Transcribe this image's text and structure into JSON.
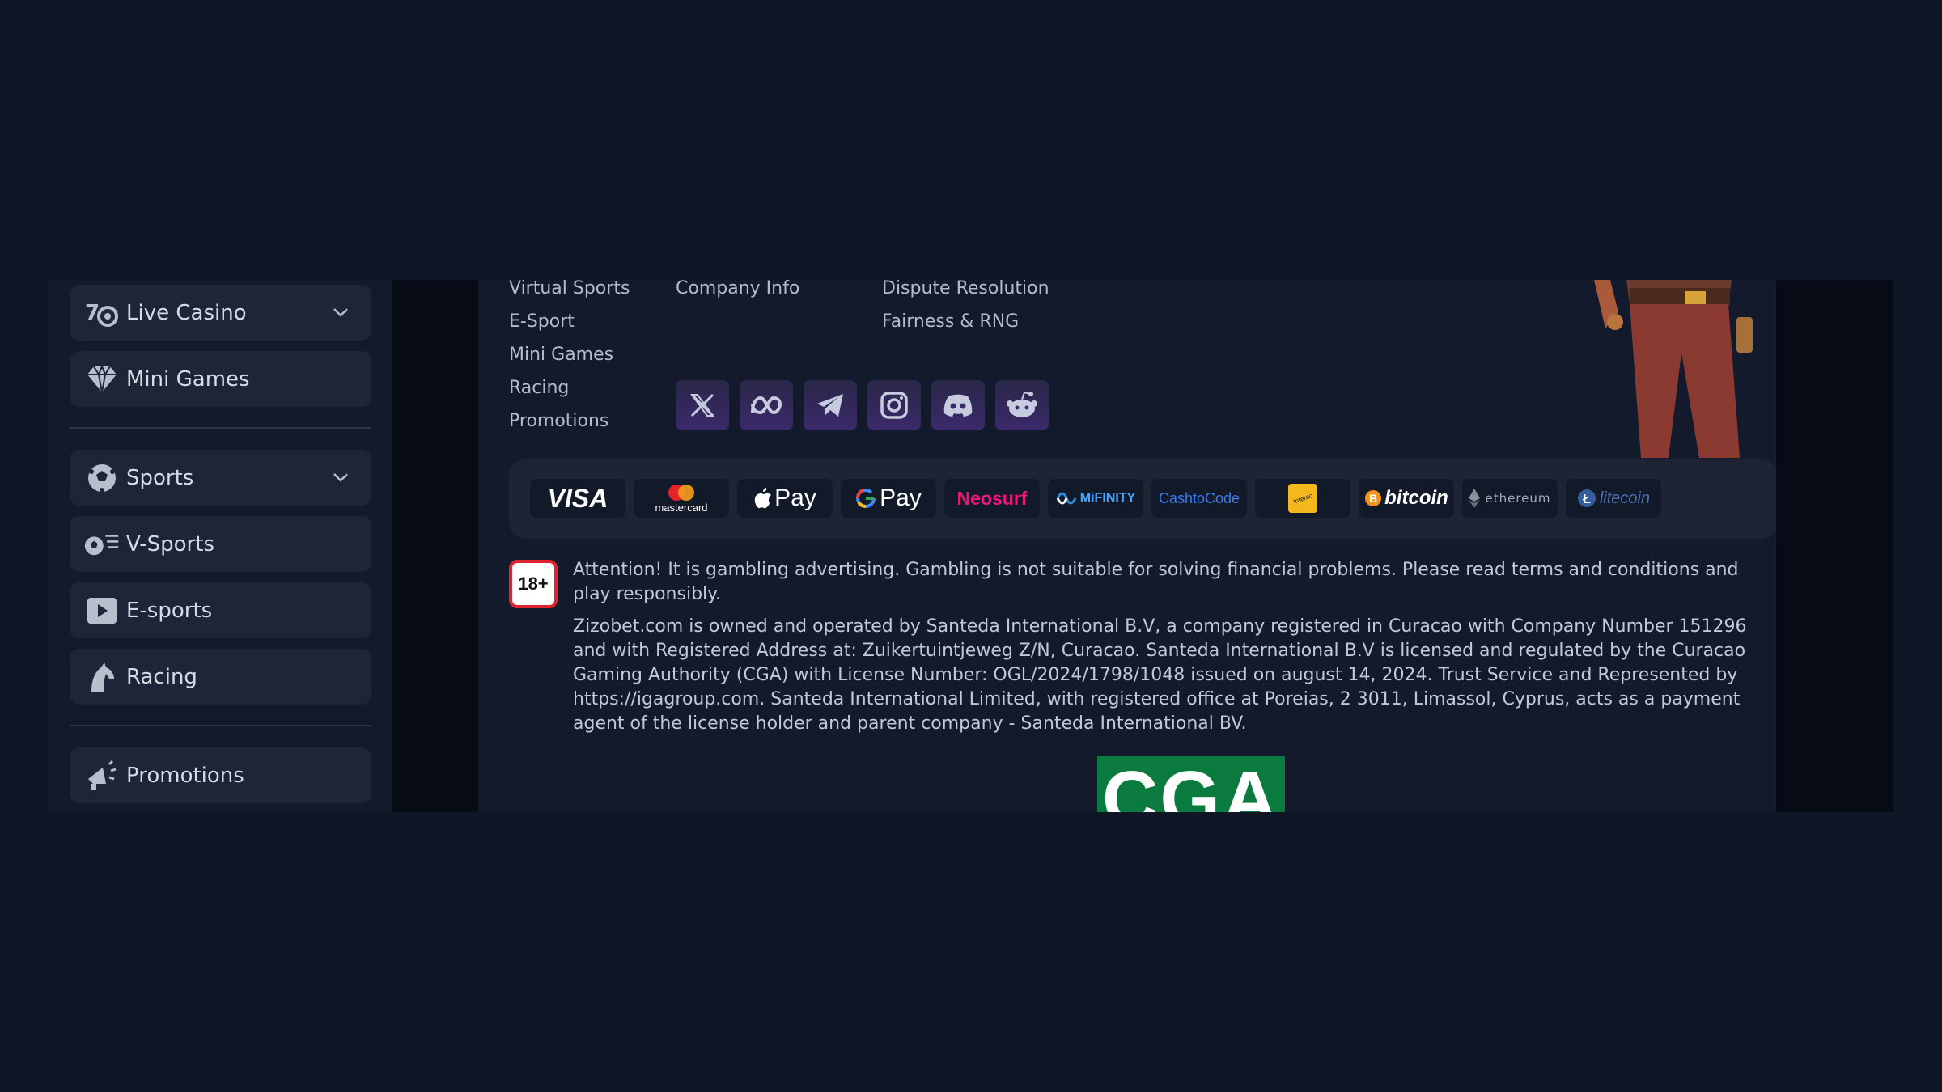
{
  "sidebar": {
    "items": [
      {
        "label": "Live Casino",
        "icon": "live-casino-icon",
        "expandable": true
      },
      {
        "label": "Mini Games",
        "icon": "diamond-icon",
        "expandable": false
      },
      {
        "label": "Sports",
        "icon": "soccer-ball-icon",
        "expandable": true
      },
      {
        "label": "V-Sports",
        "icon": "virtual-sports-icon",
        "expandable": false
      },
      {
        "label": "E-sports",
        "icon": "play-icon",
        "expandable": false
      },
      {
        "label": "Racing",
        "icon": "horse-icon",
        "expandable": false
      },
      {
        "label": "Promotions",
        "icon": "megaphone-icon",
        "expandable": false
      }
    ]
  },
  "footer": {
    "col1": [
      "Virtual Sports",
      "E-Sport",
      "Mini Games",
      "Racing",
      "Promotions"
    ],
    "col2": [
      "Company Info"
    ],
    "col3": [
      "Dispute Resolution",
      "Fairness & RNG"
    ],
    "socials": [
      "x-icon",
      "meta-icon",
      "telegram-icon",
      "instagram-icon",
      "discord-icon",
      "reddit-icon"
    ],
    "payments": [
      {
        "name": "VISA",
        "icon": "visa-logo"
      },
      {
        "name": "mastercard",
        "icon": "mastercard-logo"
      },
      {
        "name": "Pay",
        "icon": "apple-pay-logo"
      },
      {
        "name": "Pay",
        "icon": "google-pay-logo"
      },
      {
        "name": "Neosurf",
        "icon": "neosurf-logo"
      },
      {
        "name": "MiFINITY",
        "icon": "mifinity-logo"
      },
      {
        "name": "CashtoCode",
        "icon": "cashtocode-logo"
      },
      {
        "name": "Interac",
        "icon": "interac-logo"
      },
      {
        "name": "bitcoin",
        "icon": "bitcoin-logo"
      },
      {
        "name": "ethereum",
        "icon": "ethereum-logo"
      },
      {
        "name": "litecoin",
        "icon": "litecoin-logo"
      }
    ],
    "age_badge": "18+",
    "attention": "Attention! It is gambling advertising. Gambling is not suitable for solving financial problems. Please read terms and conditions and play responsibly.",
    "license": "Zizobet.com is owned and operated by Santeda International B.V, a company registered in Curacao with Company Number 151296 and with Registered Address at: Zuikertuintjeweg Z/N, Curacao. Santeda International B.V is licensed and regulated by the Curacao Gaming Authority (CGA) with License Number: OGL/2024/1798/1048 issued on august 14, 2024. Trust Service and Represented by https://igagroup.com. Santeda International Limited, with registered office at Poreias, 2 3011, Limassol, Cyprus, acts as a payment agent of the license holder and parent company - Santeda International BV.",
    "cga_logo": "CGA"
  },
  "colors": {
    "page_bg": "#0f1626",
    "panel_bg": "#121a2c",
    "item_bg": "#1d2638",
    "social_accent": "#3b2a6a",
    "age_badge_border": "#e0242f",
    "cga_green": "#0b7a3e"
  }
}
